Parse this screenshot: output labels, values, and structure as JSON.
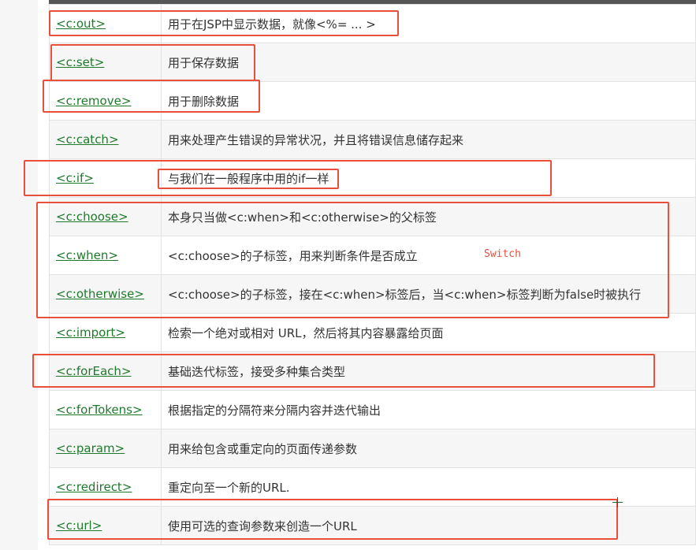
{
  "rows": [
    {
      "tag": "<c:out>",
      "desc": "用于在JSP中显示数据，就像<%= ... >"
    },
    {
      "tag": "<c:set>",
      "desc": "用于保存数据"
    },
    {
      "tag": "<c:remove>",
      "desc": "用于删除数据"
    },
    {
      "tag": "<c:catch>",
      "desc": "用来处理产生错误的异常状况，并且将错误信息储存起来"
    },
    {
      "tag": "<c:if>",
      "desc": "与我们在一般程序中用的if一样"
    },
    {
      "tag": "<c:choose>",
      "desc": "本身只当做<c:when>和<c:otherwise>的父标签"
    },
    {
      "tag": "<c:when>",
      "desc": "<c:choose>的子标签，用来判断条件是否成立"
    },
    {
      "tag": "<c:otherwise>",
      "desc": "<c:choose>的子标签，接在<c:when>标签后，当<c:when>标签判断为false时被执行"
    },
    {
      "tag": "<c:import>",
      "desc": "检索一个绝对或相对 URL，然后将其内容暴露给页面"
    },
    {
      "tag": "<c:forEach>",
      "desc": "基础迭代标签，接受多种集合类型"
    },
    {
      "tag": "<c:forTokens>",
      "desc": "根据指定的分隔符来分隔内容并迭代输出"
    },
    {
      "tag": "<c:param>",
      "desc": "用来给包含或重定向的页面传递参数"
    },
    {
      "tag": "<c:redirect>",
      "desc": "重定向至一个新的URL."
    },
    {
      "tag": "<c:url>",
      "desc": "使用可选的查询参数来创造一个URL"
    }
  ],
  "annotation": {
    "switch_note": "Switch"
  },
  "colors": {
    "link": "#1e7a2b",
    "highlight": "#e94f3a",
    "border": "#e2e2e2"
  },
  "icons": {
    "cursor": "crosshair-cursor-icon"
  }
}
